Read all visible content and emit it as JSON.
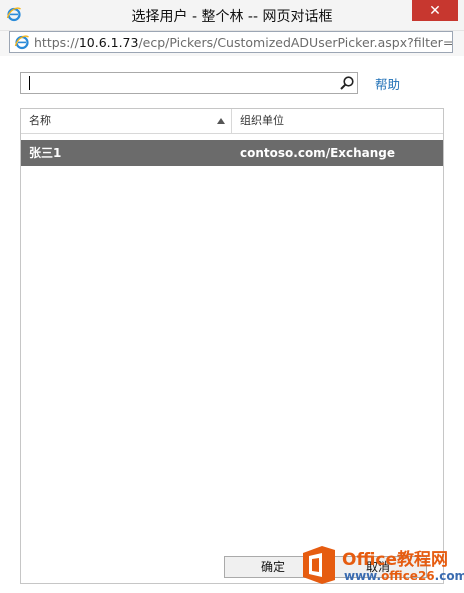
{
  "window": {
    "title": "选择用户 - 整个林 -- 网页对话框",
    "close_glyph": "✕"
  },
  "address": {
    "scheme": "https://",
    "host": "10.6.1.73",
    "path": "/ecp/Pickers/CustomizedADUserPicker.aspx?filter=Recip"
  },
  "search": {
    "value": "",
    "placeholder": ""
  },
  "help": {
    "label": "帮助"
  },
  "table": {
    "columns": [
      {
        "label": "名称"
      },
      {
        "label": "组织单位"
      }
    ],
    "rows": [
      {
        "name": "张三1",
        "ou": "contoso.com/Exchange"
      }
    ]
  },
  "buttons": {
    "ok_label": "确定",
    "cancel_label": "取消"
  },
  "watermark": {
    "title": "Office教程网",
    "url_prefix": "www.",
    "url_accent": "office26",
    "url_suffix": ".com"
  },
  "colors": {
    "selected_row": "#6b6b6b",
    "link": "#1e6fb6",
    "close_button": "#c7372f",
    "watermark_orange": "#e65c10"
  }
}
